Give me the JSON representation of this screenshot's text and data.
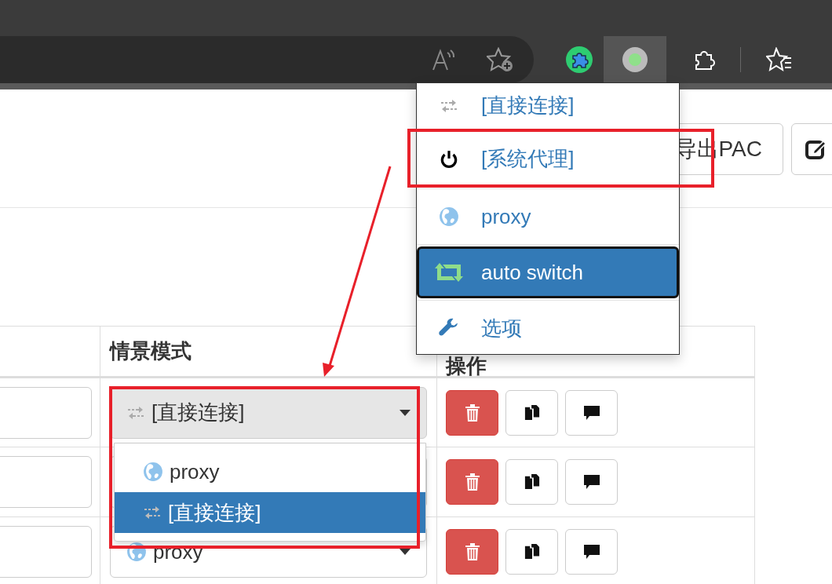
{
  "page_buttons": [
    {
      "kind": "text",
      "label": "导出PAC"
    },
    {
      "kind": "edit"
    }
  ],
  "table": {
    "columns": [
      {
        "label": "情景模式"
      },
      {
        "label": "操作"
      }
    ],
    "rows": [
      {
        "profile": "[直接连接]",
        "kind": "direct",
        "open": true,
        "options": [
          {
            "label": "proxy",
            "kind": "globe",
            "selected": false
          },
          {
            "label": "[直接连接]",
            "kind": "direct",
            "selected": true
          }
        ]
      },
      {
        "open": false
      },
      {
        "profile": "proxy",
        "kind": "globe",
        "open": false
      }
    ]
  },
  "popup_menu": {
    "items": [
      {
        "label": "[直接连接]",
        "kind": "direct",
        "selected": false
      },
      {
        "label": "[系统代理]",
        "kind": "power",
        "selected": false
      },
      {
        "label": "proxy",
        "kind": "globe",
        "selected": false
      },
      {
        "label": "auto switch",
        "kind": "switch",
        "selected": true
      },
      {
        "label": "选项",
        "kind": "wrench",
        "selected": false
      }
    ]
  }
}
